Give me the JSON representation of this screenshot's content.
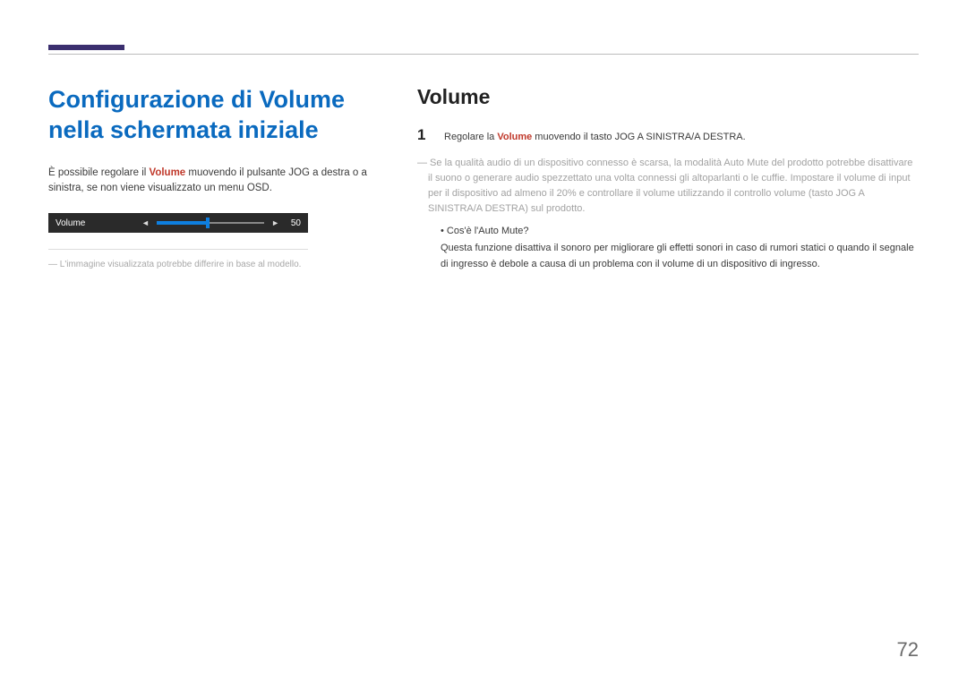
{
  "header": {
    "main_title": "Configurazione di Volume nella schermata iniziale"
  },
  "left": {
    "intro_pre": "È possibile regolare il ",
    "intro_hl": "Volume",
    "intro_post": " muovendo il pulsante JOG a destra o a sinistra, se non viene visualizzato un menu OSD.",
    "volume_label": "Volume",
    "volume_value": "50",
    "footnote": "― L'immagine visualizzata potrebbe differire in base al modello."
  },
  "right": {
    "section_title": "Volume",
    "step_num": "1",
    "step_text_pre": "Regolare la ",
    "step_text_hl": "Volume",
    "step_text_post": " muovendo il tasto JOG A SINISTRA/A DESTRA.",
    "gray_note": "― Se la qualità audio di un dispositivo connesso è scarsa, la modalità Auto Mute del prodotto potrebbe disattivare il suono o generare audio spezzettato una volta connessi gli altoparlanti o le cuffie. Impostare il volume di input per il dispositivo ad almeno il 20% e controllare il volume utilizzando il controllo volume (tasto JOG A SINISTRA/A DESTRA) sul prodotto.",
    "bullet_title": "•   Cos'è l'Auto Mute?",
    "bullet_body": "Questa funzione disattiva il sonoro per migliorare gli effetti sonori in caso di rumori statici o quando il segnale di ingresso è debole a causa di un problema con il volume di un dispositivo di ingresso."
  },
  "page_number": "72"
}
